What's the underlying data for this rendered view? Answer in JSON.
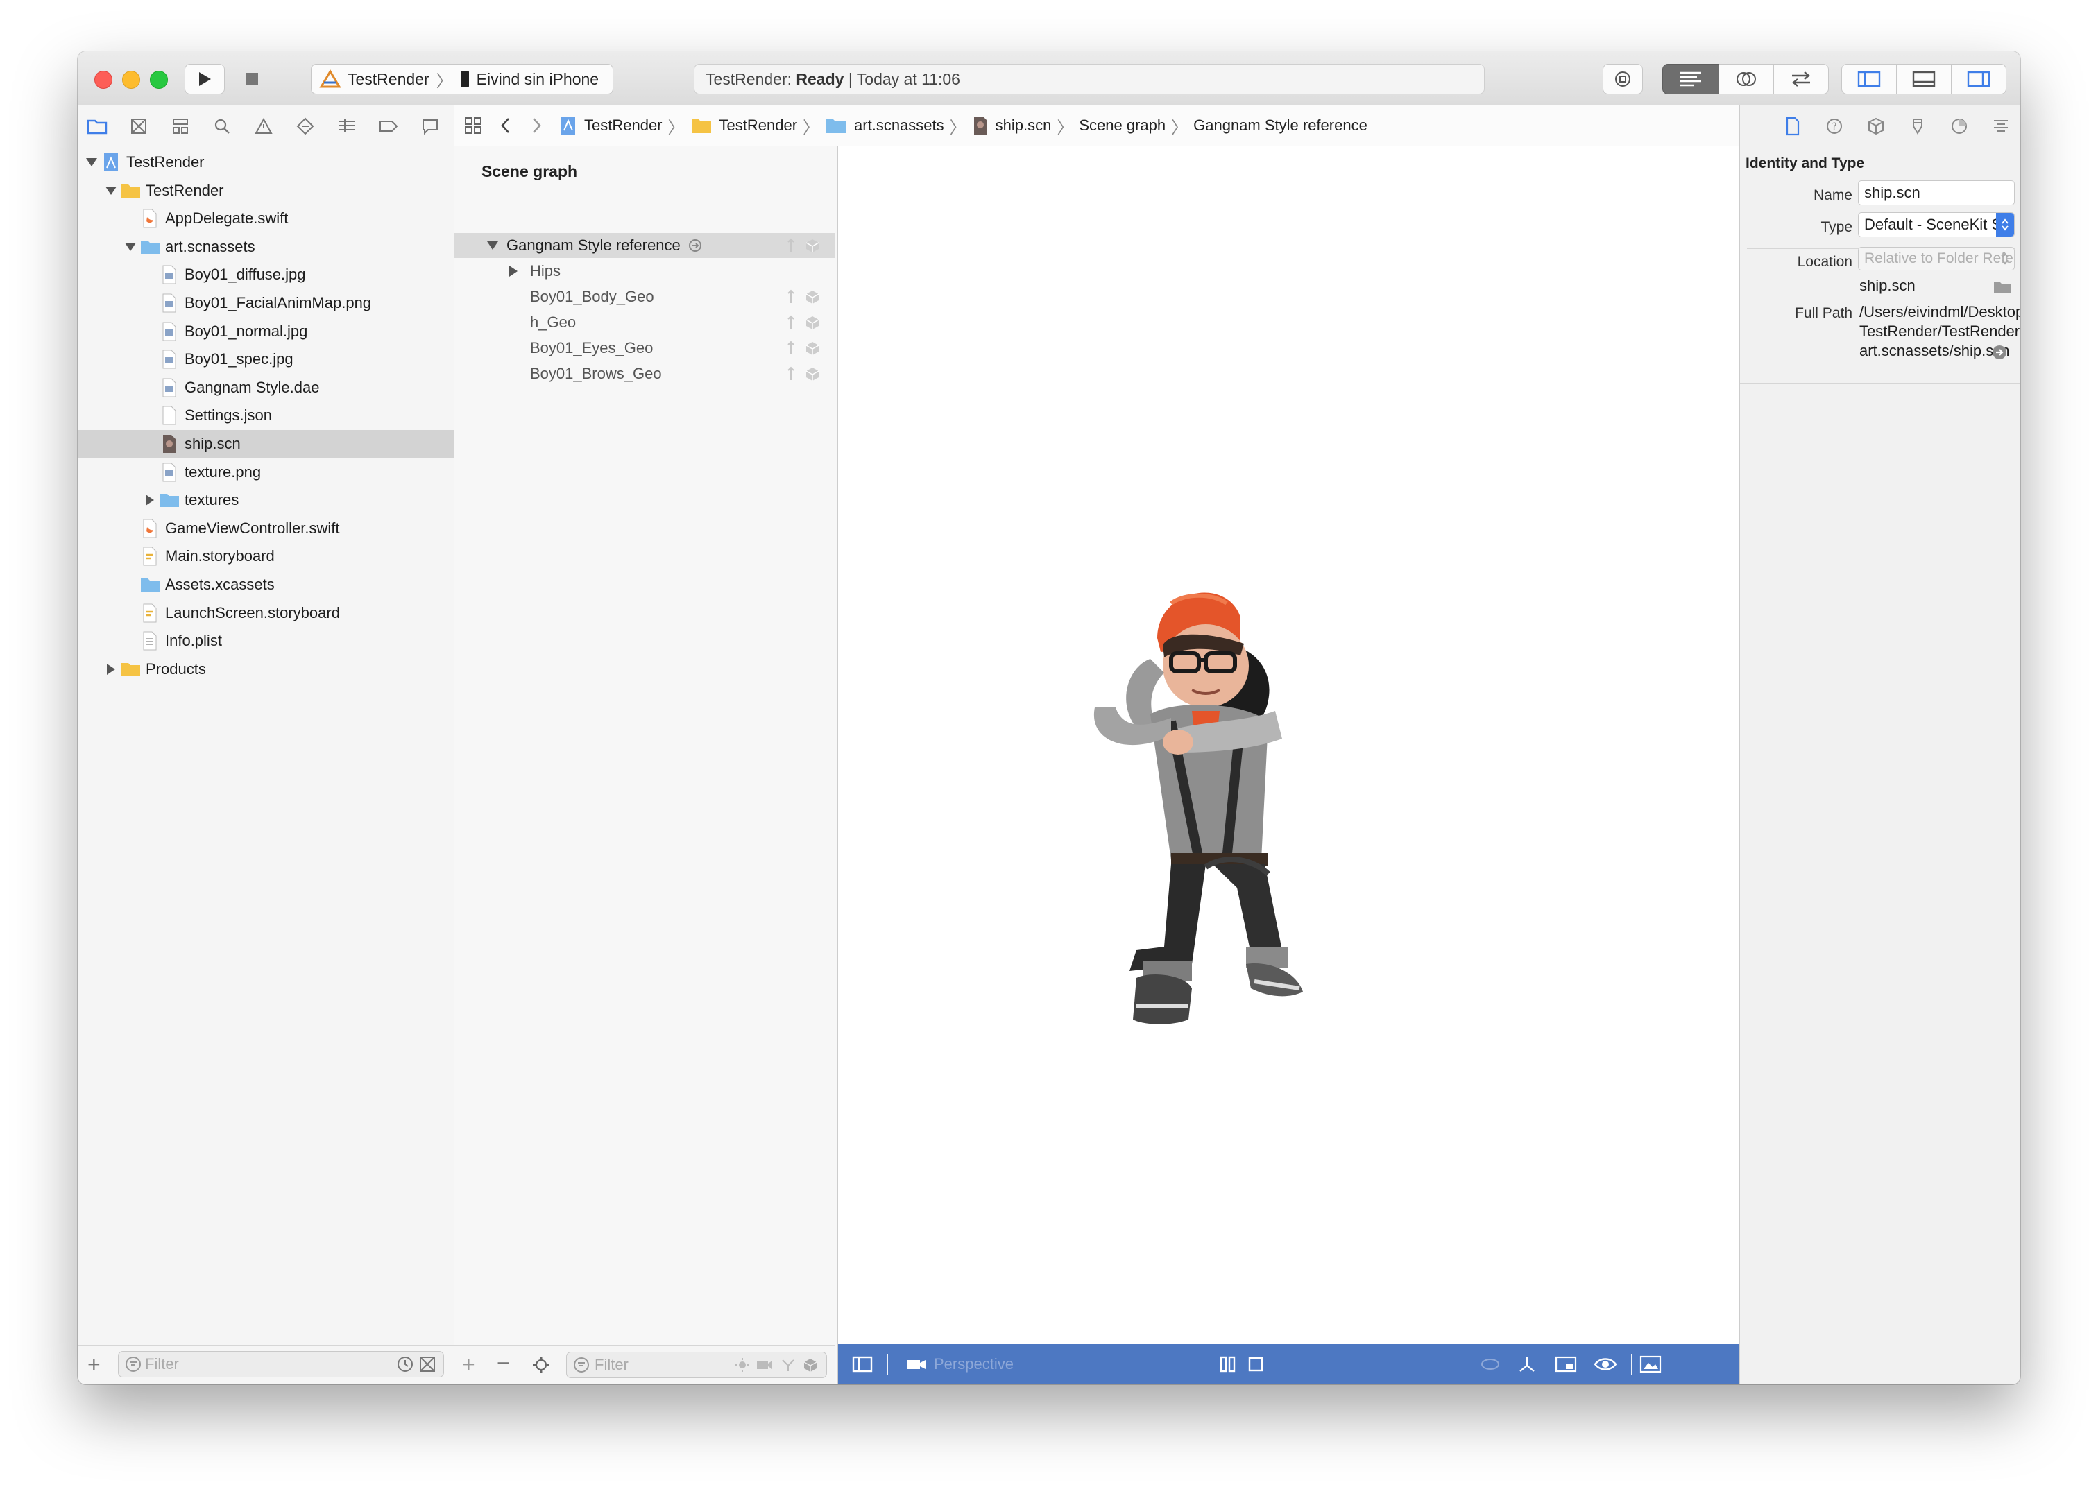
{
  "toolbar": {
    "scheme_target": "TestRender",
    "scheme_device": "Eivind sin iPhone",
    "activity_project": "TestRender:",
    "activity_status": "Ready",
    "activity_time": "| Today at 11:06"
  },
  "navigator": {
    "items": [
      {
        "label": "TestRender",
        "type": "project"
      },
      {
        "label": "TestRender",
        "type": "folder"
      },
      {
        "label": "AppDelegate.swift",
        "type": "swift"
      },
      {
        "label": "art.scnassets",
        "type": "bluefolder"
      },
      {
        "label": "Boy01_diffuse.jpg",
        "type": "image"
      },
      {
        "label": "Boy01_FacialAnimMap.png",
        "type": "image"
      },
      {
        "label": "Boy01_normal.jpg",
        "type": "image"
      },
      {
        "label": "Boy01_spec.jpg",
        "type": "image"
      },
      {
        "label": "Gangnam Style.dae",
        "type": "image"
      },
      {
        "label": "Settings.json",
        "type": "file"
      },
      {
        "label": "ship.scn",
        "type": "scene"
      },
      {
        "label": "texture.png",
        "type": "image"
      },
      {
        "label": "textures",
        "type": "bluefolder"
      },
      {
        "label": "GameViewController.swift",
        "type": "swift"
      },
      {
        "label": "Main.storyboard",
        "type": "storyboard"
      },
      {
        "label": "Assets.xcassets",
        "type": "bluefolder"
      },
      {
        "label": "LaunchScreen.storyboard",
        "type": "storyboard"
      },
      {
        "label": "Info.plist",
        "type": "plist"
      },
      {
        "label": "Products",
        "type": "folder"
      }
    ],
    "filter_placeholder": "Filter"
  },
  "jumpbar": {
    "crumbs": [
      "TestRender",
      "TestRender",
      "art.scnassets",
      "ship.scn",
      "Scene graph",
      "Gangnam Style reference"
    ]
  },
  "scene_graph": {
    "header": "Scene graph",
    "nodes": [
      {
        "label": "Gangnam Style reference"
      },
      {
        "label": "Hips"
      },
      {
        "label": "Boy01_Body_Geo"
      },
      {
        "label": "h_Geo"
      },
      {
        "label": "Boy01_Eyes_Geo"
      },
      {
        "label": "Boy01_Brows_Geo"
      }
    ],
    "filter_placeholder": "Filter"
  },
  "viewport": {
    "camera_label": "Perspective"
  },
  "inspector": {
    "section_title": "Identity and Type",
    "name_label": "Name",
    "name_value": "ship.scn",
    "type_label": "Type",
    "type_value": "Default - SceneKit Scene...",
    "location_label": "Location",
    "location_value": "Relative to Folder Referen...",
    "location_file": "ship.scn",
    "fullpath_label": "Full Path",
    "fullpath_line1": "/Users/eivindml/Desktop/",
    "fullpath_line2": "TestRender/TestRender/",
    "fullpath_line3": "art.scnassets/ship.scn"
  },
  "colors": {
    "accent": "#3f7ee8",
    "viewport_bar": "#4d78c2",
    "selection": "#d3d3d3"
  }
}
